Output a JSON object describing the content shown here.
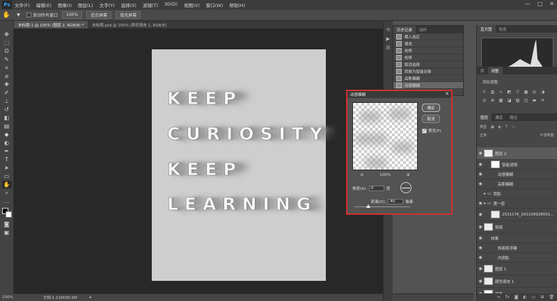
{
  "app": {
    "logo": "Ps",
    "menu": [
      "文件(F)",
      "编辑(E)",
      "图像(I)",
      "图层(L)",
      "文字(Y)",
      "选择(S)",
      "滤镜(T)",
      "3D(D)",
      "视图(V)",
      "窗口(W)",
      "帮助(H)"
    ],
    "window_controls": [
      "—",
      "□",
      "✕"
    ]
  },
  "options_bar": {
    "scroll_all_windows": "滚动所有窗口",
    "zoom_value": "100%",
    "fit_screen": "适合屏幕",
    "fill_screen": "填充屏幕"
  },
  "doc_tabs": [
    {
      "label": "未标题-1 @ 100% (图层 2, RGB/8) *",
      "active": true
    },
    {
      "label": "未标题.psd @ 100% (斯安填充 1, RGB/8)",
      "active": false
    }
  ],
  "canvas": {
    "words": [
      "KEEP",
      "CURIOSITY",
      "KEEP",
      "LEARNING"
    ]
  },
  "status": {
    "zoom": "100%",
    "doc_size": "文档:1.11M/90.5M"
  },
  "history_panel": {
    "tabs": [
      "历史记录",
      "动作"
    ],
    "items": [
      "载入选区",
      "填充",
      "栓移",
      "栓移",
      "取消选择",
      "转换为智能对象",
      "高斯模糊",
      "动感模糊"
    ]
  },
  "histogram_panel": {
    "tabs": [
      "直方图",
      "信息"
    ]
  },
  "adjustments_panel": {
    "tabs": [
      "库",
      "调整"
    ],
    "label": "添加调整"
  },
  "layers_panel": {
    "tabs": [
      "图层",
      "通道",
      "路径"
    ],
    "filter_label": "类型",
    "mode": "正常",
    "opacity_label": "不透明度:",
    "layers": [
      {
        "name": "图层 2",
        "thumb": "checker",
        "indent": 0,
        "eye": true,
        "active": true,
        "tall": true
      },
      {
        "name": "智能滤镜",
        "thumb": "white",
        "indent": 1,
        "eye": true,
        "active": false,
        "tall": false
      },
      {
        "name": "动感模糊",
        "thumb": "",
        "indent": 2,
        "eye": true,
        "active": false,
        "tall": false
      },
      {
        "name": "高斯模糊",
        "thumb": "",
        "indent": 2,
        "eye": true,
        "active": false,
        "tall": false
      },
      {
        "name": "阴影",
        "thumb": "folder",
        "indent": 0,
        "eye": false,
        "active": false,
        "tall": false
      },
      {
        "name": "第一层",
        "thumb": "folder",
        "indent": 0,
        "eye": true,
        "active": false,
        "tall": false
      },
      {
        "name": "2531176_201109928001...",
        "thumb": "dark",
        "indent": 1,
        "eye": true,
        "active": false,
        "tall": true
      },
      {
        "name": "剪纸",
        "thumb": "dark",
        "indent": 0,
        "eye": true,
        "active": false,
        "tall": true
      },
      {
        "name": "效果",
        "thumb": "",
        "indent": 1,
        "eye": true,
        "active": false,
        "tall": false
      },
      {
        "name": "斜面和浮雕",
        "thumb": "",
        "indent": 2,
        "eye": true,
        "active": false,
        "tall": false
      },
      {
        "name": "内阴影",
        "thumb": "",
        "indent": 2,
        "eye": true,
        "active": false,
        "tall": false
      },
      {
        "name": "图层 1",
        "thumb": "checker",
        "indent": 0,
        "eye": true,
        "active": false,
        "tall": true
      },
      {
        "name": "颜色填充 1",
        "thumb": "dark",
        "indent": 0,
        "eye": true,
        "active": false,
        "tall": true
      },
      {
        "name": "背景",
        "thumb": "white",
        "indent": 0,
        "eye": true,
        "active": false,
        "tall": true
      }
    ],
    "fx_symbol": "fx"
  },
  "dialog": {
    "title": "动感模糊",
    "ok": "确定",
    "cancel": "取消",
    "preview_label": "预览(P)",
    "zoom": "100%",
    "angle_label": "角度(A):",
    "angle_value": "0",
    "angle_unit": "度",
    "distance_label": "距离(D):",
    "distance_value": "40",
    "distance_unit": "像素",
    "distance_fraction": 0.25
  }
}
